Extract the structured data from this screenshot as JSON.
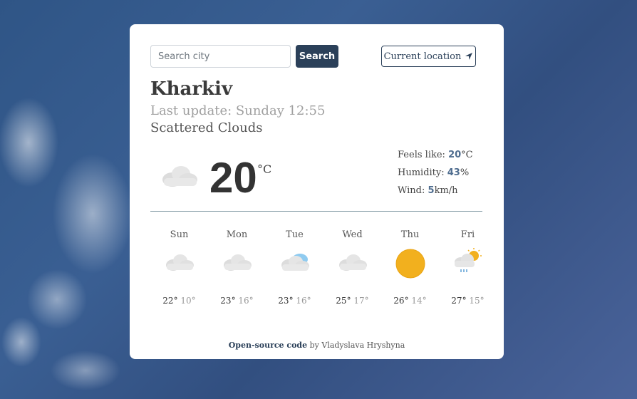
{
  "search": {
    "placeholder": "Search city",
    "button_label": "Search"
  },
  "location_button_label": "Current location",
  "weather": {
    "city": "Kharkiv",
    "last_update": "Last update: Sunday 12:55",
    "description": "Scattered Clouds",
    "temperature": "20",
    "unit": "°C",
    "icon": "cloud-icon",
    "feels_like_label": "Feels like:",
    "feels_like_value": "20",
    "feels_like_unit": "°C",
    "humidity_label": "Humidity:",
    "humidity_value": "43",
    "humidity_unit": "%",
    "wind_label": "Wind:",
    "wind_value": "5",
    "wind_unit": "km/h"
  },
  "forecast": [
    {
      "day": "Sun",
      "high": "22°",
      "low": "10°",
      "icon": "cloud-icon"
    },
    {
      "day": "Mon",
      "high": "23°",
      "low": "16°",
      "icon": "cloud-icon"
    },
    {
      "day": "Tue",
      "high": "23°",
      "low": "16°",
      "icon": "cloud-icon"
    },
    {
      "day": "Wed",
      "high": "25°",
      "low": "17°",
      "icon": "cloud-icon"
    },
    {
      "day": "Thu",
      "high": "26°",
      "low": "14°",
      "icon": "sun-icon"
    },
    {
      "day": "Fri",
      "high": "27°",
      "low": "15°",
      "icon": "rain-sun-icon"
    }
  ],
  "footer": {
    "link_text": "Open-source code",
    "author": " by Vladyslava Hryshyna"
  },
  "colors": {
    "accent": "#2b4059",
    "value": "#4f6d8f",
    "sun": "#f2b01e"
  }
}
